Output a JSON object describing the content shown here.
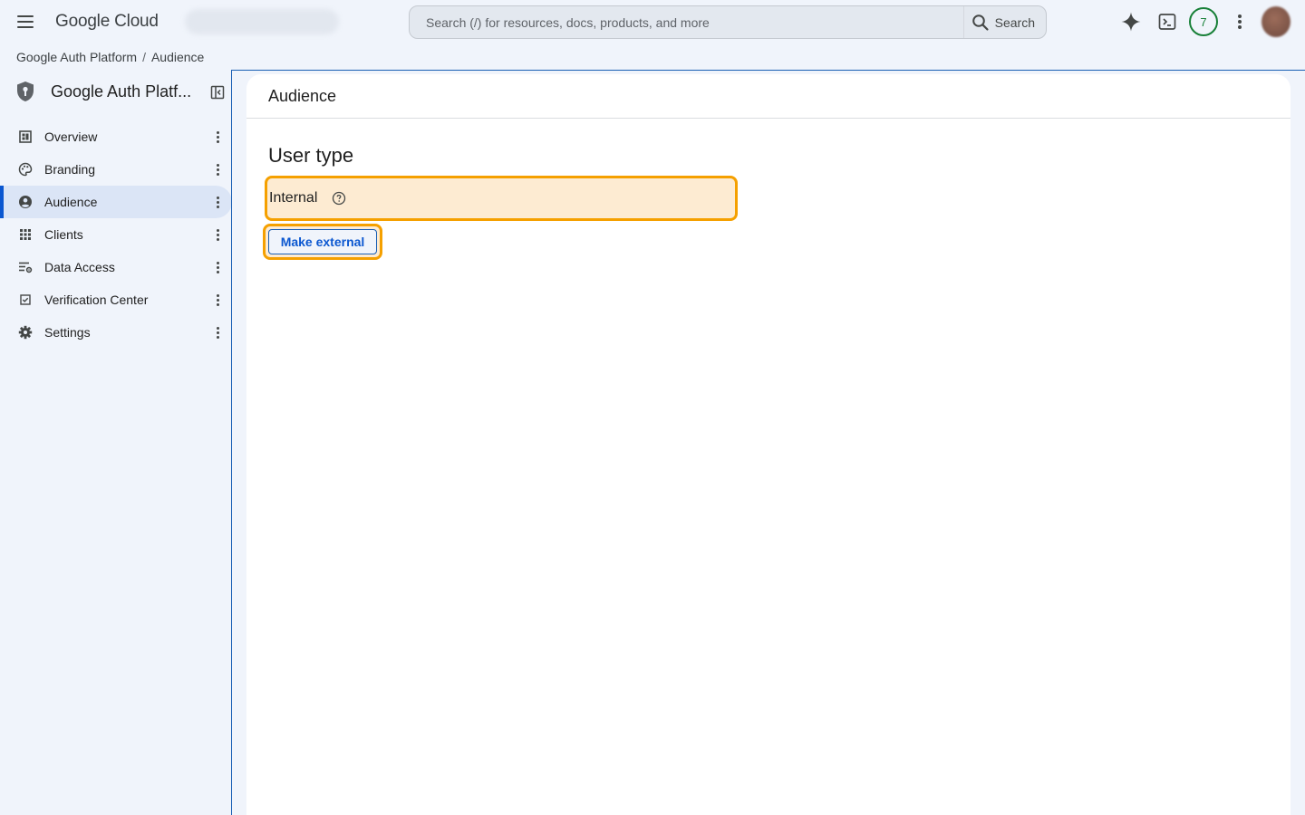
{
  "topbar": {
    "brand": "Google Cloud",
    "search_placeholder": "Search (/) for resources, docs, products, and more",
    "search_button": "Search",
    "notification_count": "7"
  },
  "breadcrumb": {
    "items": [
      "Google Auth Platform",
      "Audience"
    ],
    "separator": "/"
  },
  "sidebar": {
    "product_title": "Google Auth Platf...",
    "items": [
      {
        "label": "Overview",
        "icon": "dashboard-icon"
      },
      {
        "label": "Branding",
        "icon": "palette-icon"
      },
      {
        "label": "Audience",
        "icon": "person-icon",
        "active": true
      },
      {
        "label": "Clients",
        "icon": "apps-grid-icon"
      },
      {
        "label": "Data Access",
        "icon": "tune-settings-icon"
      },
      {
        "label": "Verification Center",
        "icon": "checkbox-icon"
      },
      {
        "label": "Settings",
        "icon": "gear-icon"
      }
    ]
  },
  "main": {
    "header": "Audience",
    "section_title": "User type",
    "user_type_value": "Internal",
    "make_external_label": "Make external"
  },
  "colors": {
    "accent": "#0b57d0",
    "highlight_border": "#f5a000",
    "highlight_fill": "#fdebd2",
    "badge_green": "#188038"
  }
}
